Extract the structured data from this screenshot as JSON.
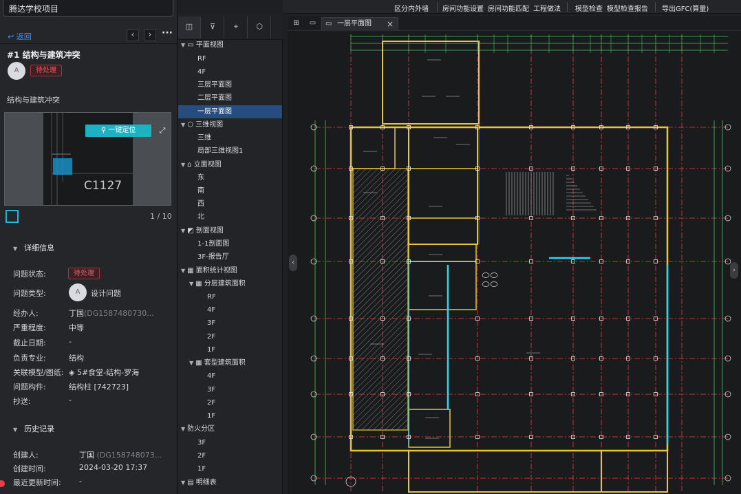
{
  "project": {
    "name": "腾达学校项目"
  },
  "nav": {
    "back": "返回",
    "prev_icon": "‹",
    "next_icon": "›",
    "more": "···"
  },
  "issue": {
    "title": "#1 结构与建筑冲突",
    "avatar_initial": "A",
    "status_badge": "待处理",
    "subtitle": "结构与建筑冲突",
    "locate_button": "一键定位",
    "thumb_label": "C1127",
    "pager": "1 / 10"
  },
  "details": {
    "heading": "详细信息",
    "status_key": "问题状态:",
    "status_val": "待处理",
    "type_key": "问题类型:",
    "type_avatar": "A",
    "type_val": "设计问题",
    "assignee_key": "经办人:",
    "assignee_name": "丁国",
    "assignee_id": "(DG1587480730...",
    "severity_key": "严重程度:",
    "severity_val": "中等",
    "due_key": "截止日期:",
    "due_val": "-",
    "discipline_key": "负责专业:",
    "discipline_val": "结构",
    "model_key": "关联模型/图纸:",
    "model_val": "5#食堂-结构-罗海",
    "component_key": "问题构件:",
    "component_val": "结构柱 [742723]",
    "cc_key": "抄送:",
    "cc_val": "-"
  },
  "history": {
    "heading": "历史记录",
    "creator_key": "创建人:",
    "creator_name": "丁国",
    "creator_id": "(DG158748073...",
    "created_key": "创建时间:",
    "created_val": "2024-03-20 17:37",
    "updated_key": "最近更新时间:",
    "updated_val": "-"
  },
  "toolbar": {
    "items": [
      "区分内外墙",
      "房间功能设置",
      "房间功能匹配",
      "工程做法",
      "模型检查",
      "模型检查报告",
      "导出GFC(算量)"
    ]
  },
  "tab": {
    "label": "一层平面图"
  },
  "tree": {
    "plan_views": "平面视图",
    "plan_items": [
      "RF",
      "4F",
      "三层平面图",
      "二层平面图",
      "一层平面图"
    ],
    "views_3d": "三维视图",
    "items_3d": [
      "三维",
      "局部三维视图1"
    ],
    "elevations": "立面视图",
    "elevation_items": [
      "东",
      "南",
      "西",
      "北"
    ],
    "sections": "剖面视图",
    "section_items": [
      "1-1剖面图",
      "3F-报告厅"
    ],
    "area_stats": "面积统计视图",
    "floor_area": "分层建筑面积",
    "floor_area_items": [
      "RF",
      "4F",
      "3F",
      "2F",
      "1F"
    ],
    "room_area": "套型建筑面积",
    "room_area_items": [
      "4F",
      "3F",
      "2F",
      "1F"
    ],
    "fire_zones": "防火分区",
    "fire_items": [
      "3F",
      "2F",
      "1F"
    ],
    "schedules": "明细表"
  },
  "colors": {
    "accent": "#1cb2c3",
    "link": "#3d8ef0",
    "danger": "#ef5a64",
    "selection": "#274c80"
  }
}
